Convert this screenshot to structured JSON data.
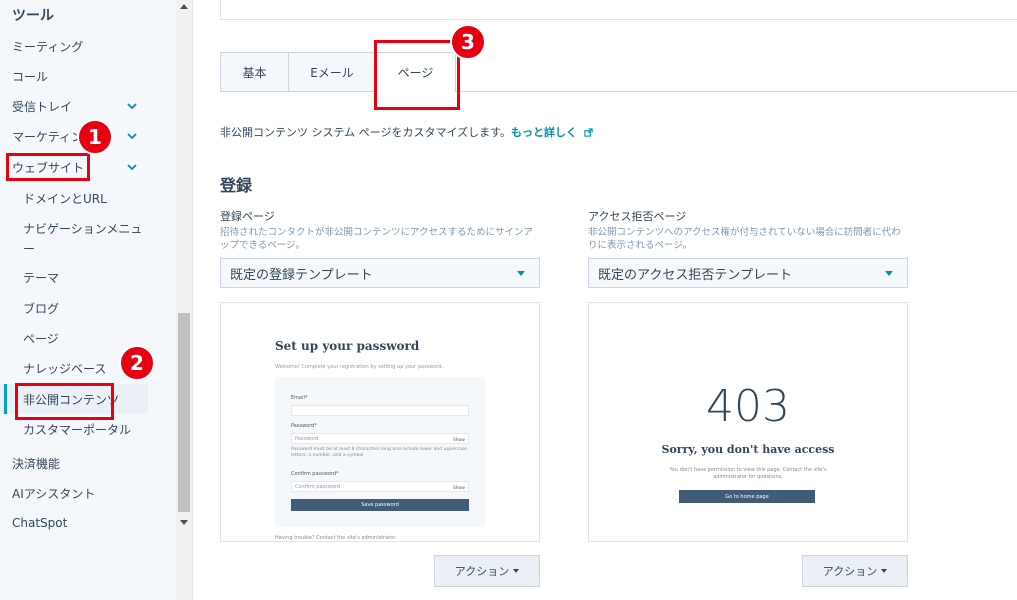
{
  "sidebar": {
    "title": "ツール",
    "items": [
      {
        "label": "ミーティング"
      },
      {
        "label": "コール"
      },
      {
        "label": "受信トレイ"
      },
      {
        "label": "マーケティング"
      },
      {
        "label": "ウェブサイト"
      },
      {
        "label": "ドメインとURL"
      },
      {
        "label": "ナビゲーションメニュ"
      },
      {
        "label": "ー"
      },
      {
        "label": "テーマ"
      },
      {
        "label": "ブログ"
      },
      {
        "label": "ページ"
      },
      {
        "label": "ナレッジベース"
      },
      {
        "label": "非公開コンテンツ"
      },
      {
        "label": "カスタマーポータル"
      },
      {
        "label": "決済機能"
      },
      {
        "label": "AIアシスタント"
      },
      {
        "label": "ChatSpot"
      }
    ]
  },
  "tabs": [
    {
      "label": "基本"
    },
    {
      "label": "Eメール"
    },
    {
      "label": "ページ"
    }
  ],
  "description": {
    "text": "非公開コンテンツ システム ページをカスタマイズします。",
    "link": "もっと詳しく"
  },
  "section": {
    "title": "登録"
  },
  "registration": {
    "label": "登録ページ",
    "help": "招待されたコンタクトが非公開コンテンツにアクセスするためにサインアップできるページ。",
    "select_value": "既定の登録テンプレート",
    "action_label": "アクション",
    "preview": {
      "title": "Set up your password",
      "subtitle": "Welcome! Complete your registration by setting up your password.",
      "email_label": "Email*",
      "password_label": "Password*",
      "password_placeholder": "Password",
      "show_label": "Show",
      "password_help": "Password must be at least 8 characters long and include lower and uppercase letters, a number, and a symbol",
      "confirm_label": "Confirm password*",
      "confirm_placeholder": "Confirm password",
      "save_button": "Save password",
      "footer": "Having trouble? Contact the site's administrator."
    }
  },
  "access_denied": {
    "label": "アクセス拒否ページ",
    "help": "非公開コンテンツへのアクセス権が付与されていない場合に訪問者に代わりに表示されるページ。",
    "select_value": "既定のアクセス拒否テンプレート",
    "action_label": "アクション",
    "preview": {
      "code": "403",
      "heading": "Sorry, you don't have access",
      "message": "You don't have permission to view this page. Contact the site's administrator for questions.",
      "button": "Go to home page"
    }
  },
  "annotations": [
    {
      "number": "1"
    },
    {
      "number": "2"
    },
    {
      "number": "3"
    }
  ],
  "colors": {
    "annotation_red": "#e60012",
    "link_teal": "#0091ae",
    "text_dark": "#33475b",
    "sidebar_bg": "#f5f8fa"
  }
}
